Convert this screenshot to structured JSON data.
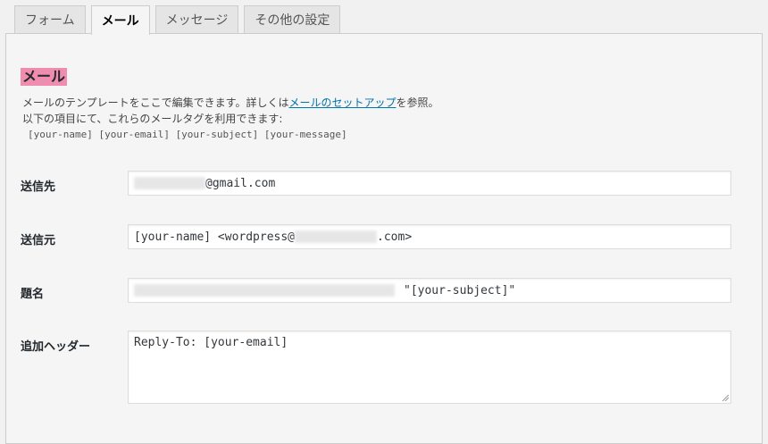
{
  "tabs": [
    {
      "label": "フォーム",
      "active": false
    },
    {
      "label": "メール",
      "active": true
    },
    {
      "label": "メッセージ",
      "active": false
    },
    {
      "label": "その他の設定",
      "active": false
    }
  ],
  "section": {
    "title": "メール",
    "desc_line1_prefix": "メールのテンプレートをここで編集できます。詳しくは",
    "desc_link": "メールのセットアップ",
    "desc_line1_suffix": "を参照。",
    "desc_line2": "以下の項目にて、これらのメールタグを利用できます:",
    "mail_tags": "[your-name] [your-email] [your-subject] [your-message]"
  },
  "fields": {
    "to": {
      "label": "送信先",
      "value_suffix": "@gmail.com"
    },
    "from": {
      "label": "送信元",
      "value_prefix": "[your-name] <wordpress@",
      "value_suffix": ".com>"
    },
    "subject": {
      "label": "題名",
      "value_suffix": "\"[your-subject]\""
    },
    "headers": {
      "label": "追加ヘッダー",
      "value": "Reply-To: [your-email]"
    }
  },
  "colors": {
    "title_highlight": "#f08cad",
    "link": "#0073aa"
  }
}
